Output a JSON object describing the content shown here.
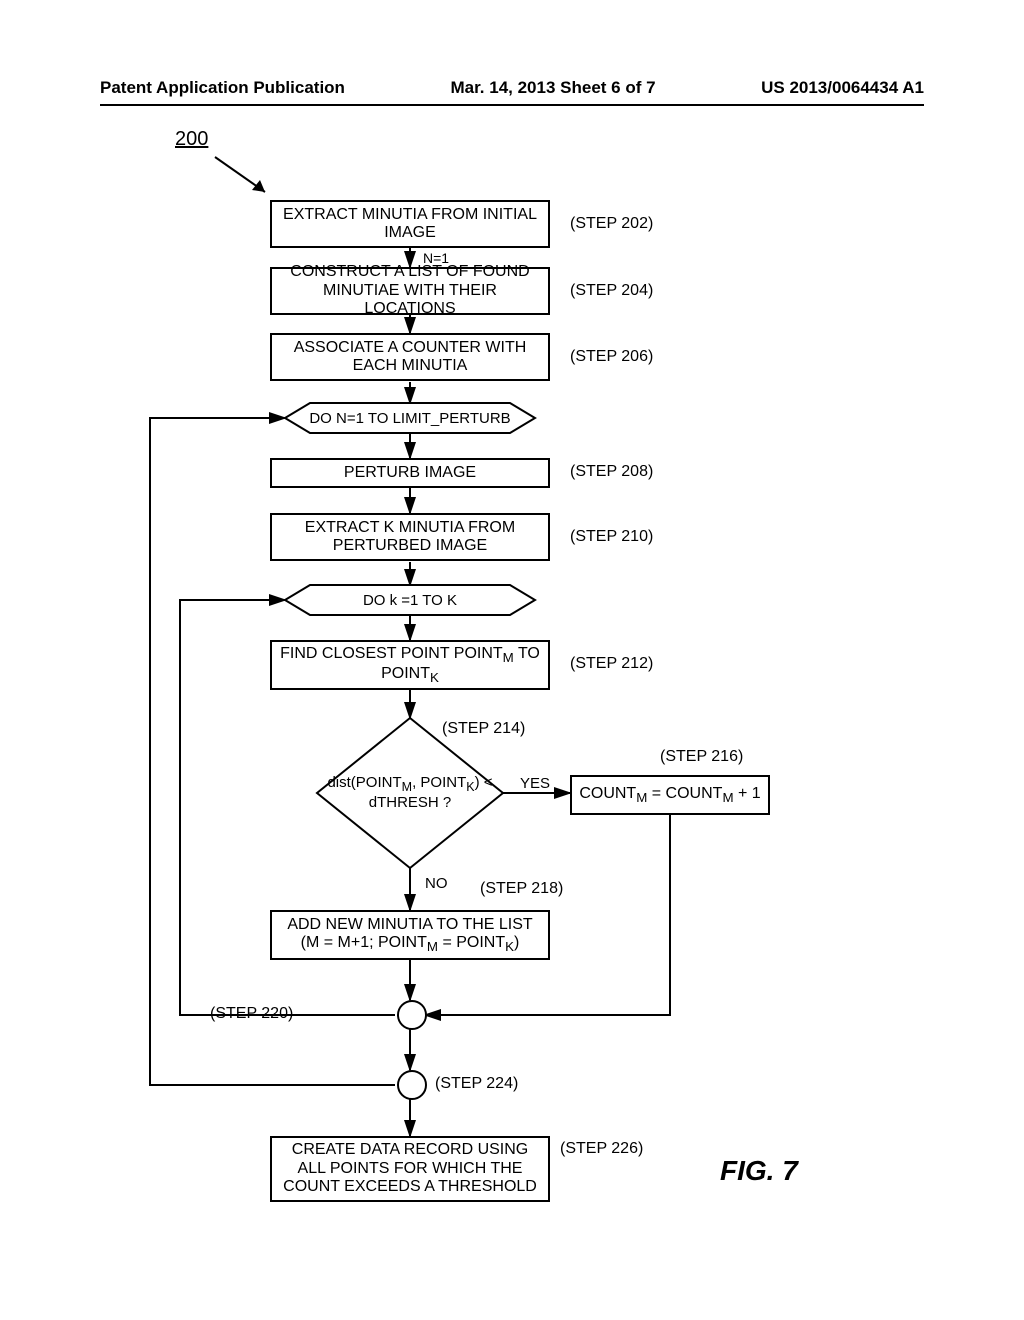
{
  "header": {
    "left": "Patent Application Publication",
    "mid": "Mar. 14, 2013  Sheet 6 of 7",
    "right": "US 2013/0064434 A1"
  },
  "reference_numeral": "200",
  "figure_label": "FIG. 7",
  "steps": {
    "s202": {
      "text": "EXTRACT MINUTIA FROM INITIAL IMAGE",
      "label": "(STEP 202)"
    },
    "n1": {
      "text": "N=1"
    },
    "s204": {
      "text": "CONSTRUCT A LIST OF FOUND MINUTIAE WITH THEIR LOCATIONS",
      "label": "(STEP 204)"
    },
    "s206": {
      "text": "ASSOCIATE A COUNTER WITH EACH MINUTIA",
      "label": "(STEP 206)"
    },
    "loop1": {
      "text": "DO N=1 TO LIMIT_PERTURB"
    },
    "s208": {
      "text": "PERTURB IMAGE",
      "label": "(STEP 208)"
    },
    "s210": {
      "text": "EXTRACT K MINUTIA FROM PERTURBED IMAGE",
      "label": "(STEP 210)"
    },
    "loop2": {
      "text": "DO k =1 TO K"
    },
    "s212": {
      "text_html": "FIND CLOSEST POINT POINT<sub>M</sub> TO POINT<sub>K</sub>",
      "label": "(STEP 212)"
    },
    "s214": {
      "text_html": "dist(POINT<sub>M</sub>, POINT<sub>K</sub>) &lt; dTHRESH ?",
      "label": "(STEP 214)"
    },
    "branch_yes": "YES",
    "branch_no": "NO",
    "s216": {
      "text_html": "COUNT<sub>M</sub> = COUNT<sub>M</sub> + 1",
      "label": "(STEP 216)"
    },
    "s218": {
      "text_html": "ADD NEW MINUTIA TO THE LIST (M = M+1; POINT<sub>M</sub> = POINT<sub>K</sub>)",
      "label": "(STEP 218)"
    },
    "s220": {
      "label": "(STEP 220)"
    },
    "s224": {
      "label": "(STEP 224)"
    },
    "s226": {
      "text": "CREATE DATA RECORD USING ALL POINTS FOR WHICH THE COUNT EXCEEDS A THRESHOLD",
      "label": "(STEP 226)"
    }
  },
  "chart_data": {
    "type": "flowchart",
    "title": "FIG. 7",
    "reference": "200",
    "nodes": [
      {
        "id": "202",
        "type": "process",
        "text": "EXTRACT MINUTIA FROM INITIAL IMAGE"
      },
      {
        "id": "n1",
        "type": "label",
        "text": "N=1"
      },
      {
        "id": "204",
        "type": "process",
        "text": "CONSTRUCT A LIST OF FOUND MINUTIAE WITH THEIR LOCATIONS"
      },
      {
        "id": "206",
        "type": "process",
        "text": "ASSOCIATE A COUNTER WITH EACH MINUTIA"
      },
      {
        "id": "loopN",
        "type": "loop",
        "text": "DO N=1 TO LIMIT_PERTURB"
      },
      {
        "id": "208",
        "type": "process",
        "text": "PERTURB IMAGE"
      },
      {
        "id": "210",
        "type": "process",
        "text": "EXTRACT K MINUTIA FROM PERTURBED IMAGE"
      },
      {
        "id": "loopK",
        "type": "loop",
        "text": "DO k =1 TO K"
      },
      {
        "id": "212",
        "type": "process",
        "text": "FIND CLOSEST POINT POINT_M TO POINT_K"
      },
      {
        "id": "214",
        "type": "decision",
        "text": "dist(POINT_M, POINT_K) < dTHRESH ?"
      },
      {
        "id": "216",
        "type": "process",
        "text": "COUNT_M = COUNT_M + 1"
      },
      {
        "id": "218",
        "type": "process",
        "text": "ADD NEW MINUTIA TO THE LIST (M = M+1; POINT_M = POINT_K)"
      },
      {
        "id": "220",
        "type": "connector"
      },
      {
        "id": "224",
        "type": "connector"
      },
      {
        "id": "226",
        "type": "process",
        "text": "CREATE DATA RECORD USING ALL POINTS FOR WHICH THE COUNT EXCEEDS A THRESHOLD"
      }
    ],
    "edges": [
      {
        "from": "202",
        "to": "204"
      },
      {
        "from": "204",
        "to": "206"
      },
      {
        "from": "206",
        "to": "loopN"
      },
      {
        "from": "loopN",
        "to": "208"
      },
      {
        "from": "208",
        "to": "210"
      },
      {
        "from": "210",
        "to": "loopK"
      },
      {
        "from": "loopK",
        "to": "212"
      },
      {
        "from": "212",
        "to": "214"
      },
      {
        "from": "214",
        "to": "216",
        "label": "YES"
      },
      {
        "from": "214",
        "to": "218",
        "label": "NO"
      },
      {
        "from": "216",
        "to": "220"
      },
      {
        "from": "218",
        "to": "220"
      },
      {
        "from": "220",
        "to": "loopK",
        "loop_back": true
      },
      {
        "from": "220",
        "to": "224"
      },
      {
        "from": "224",
        "to": "loopN",
        "loop_back": true
      },
      {
        "from": "224",
        "to": "226"
      }
    ]
  }
}
